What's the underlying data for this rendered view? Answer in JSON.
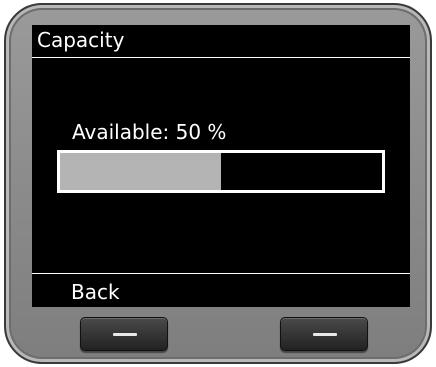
{
  "screen": {
    "title": "Capacity",
    "status_text": "Available: 50 %",
    "progress_fraction": 0.5,
    "softkey_left_label": "Back"
  },
  "hardware": {
    "left_key_icon": "dash-icon",
    "right_key_icon": "dash-icon"
  },
  "colors": {
    "screen_background": "#000000",
    "text": "#ffffff",
    "progress_fill": "#b4b4b4"
  }
}
